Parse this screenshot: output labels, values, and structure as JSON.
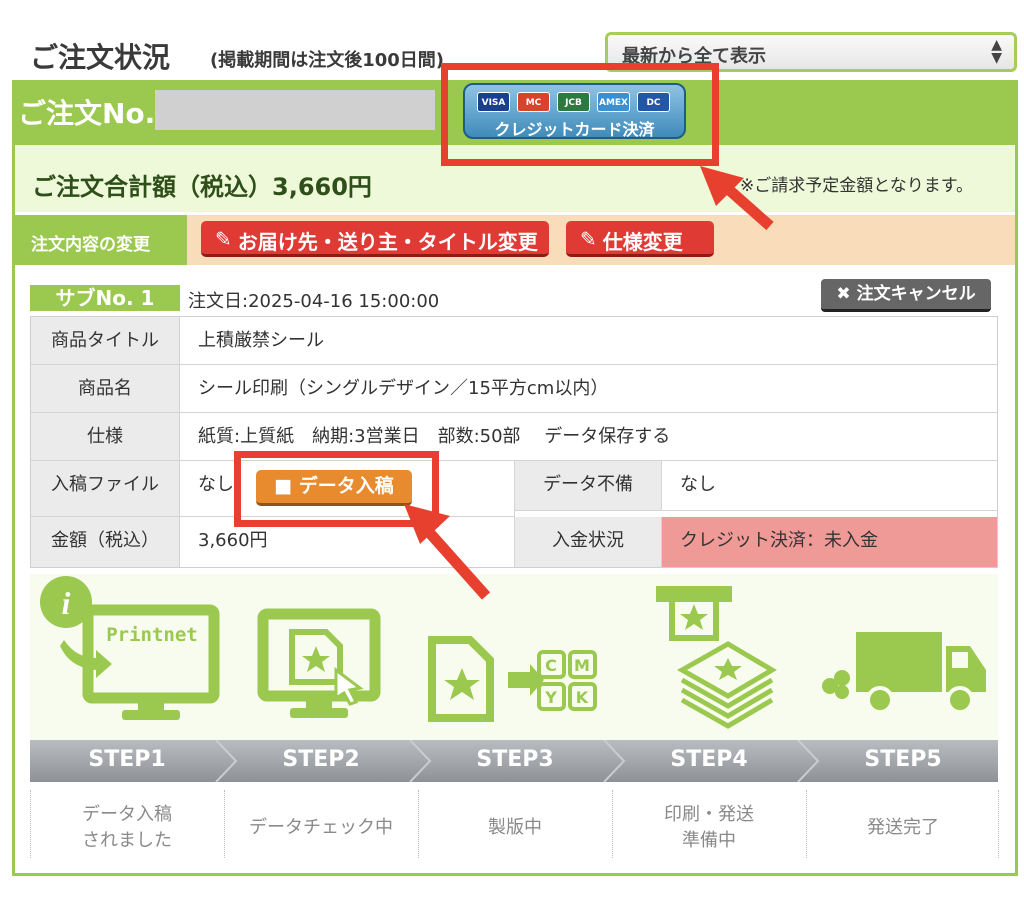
{
  "header": {
    "title": "ご注文状況",
    "period_note": "(掲載期間は注文後100日間)",
    "display_select": "最新から全て表示"
  },
  "order": {
    "label": "ご注文No.",
    "credit_button": "クレジットカード決済",
    "card_brands": [
      "VISA",
      "MC",
      "JCB",
      "AMEX",
      "DC"
    ],
    "total": "ご注文合計額（税込）3,660円",
    "total_note": "※ご請求予定金額となります。"
  },
  "change": {
    "label": "注文内容の変更",
    "address_button": "お届け先・送り主・タイトル変更",
    "spec_button": "仕様変更"
  },
  "sub": {
    "label": "サブNo. 1",
    "order_date": "注文日:2025-04-16 15:00:00",
    "cancel_button": "注文キャンセル"
  },
  "table": {
    "product_title_label": "商品タイトル",
    "product_title": "上積厳禁シール",
    "product_name_label": "商品名",
    "product_name": "シール印刷（シングルデザイン／15平方cm以内）",
    "spec_label": "仕様",
    "spec": "紙質:上質紙　納期:3営業日　部数:50部　 データ保存する",
    "file_label": "入稿ファイル",
    "file_value": "なし",
    "upload_button": "データ入稿",
    "data_missing_label": "データ不備",
    "data_missing_value": "なし",
    "amount_label": "金額（税込）",
    "amount": "3,660円",
    "payment_label": "入金状況",
    "payment_value": "クレジット決済：未入金"
  },
  "steps": {
    "labels": [
      "STEP1",
      "STEP2",
      "STEP3",
      "STEP4",
      "STEP5"
    ],
    "descriptions": [
      "データ入稿\nされました",
      "データチェック中",
      "製版中",
      "印刷・発送\n準備中",
      "発送完了"
    ],
    "monitor_text": "Printnet",
    "cmyk": [
      "C",
      "M",
      "Y",
      "K"
    ]
  },
  "colors": {
    "green": "#9bc84e",
    "red_button": "#e03a35",
    "orange_button": "#e88a2e",
    "annotation_red": "#e8402f",
    "pink_status": "#f09a98"
  }
}
